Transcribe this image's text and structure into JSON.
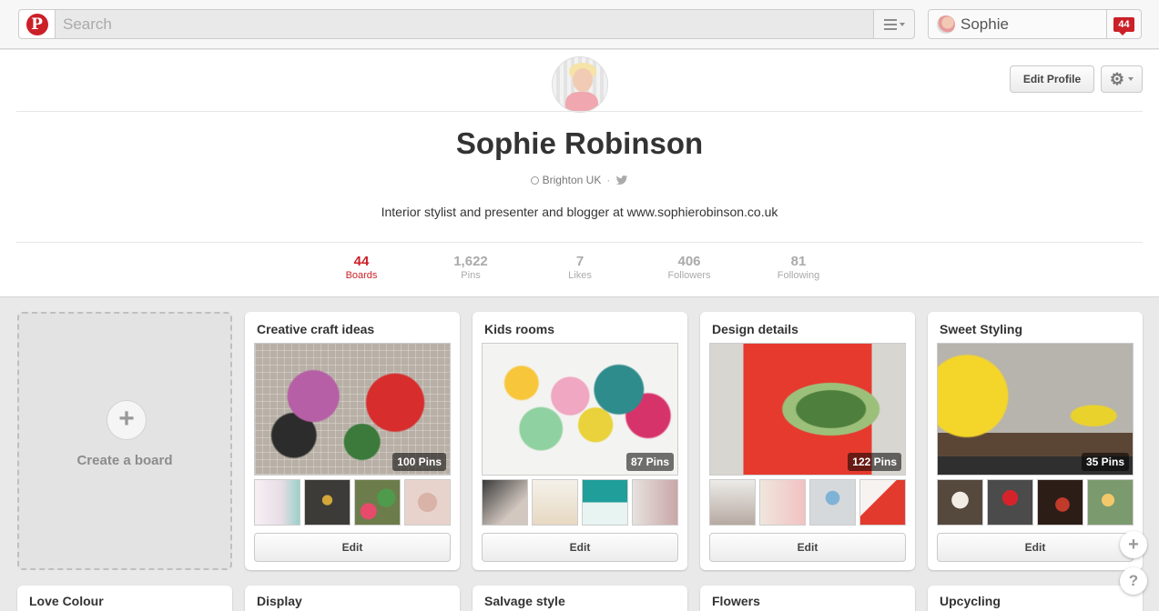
{
  "header": {
    "logo_letter": "P",
    "search_placeholder": "Search",
    "user_name": "Sophie",
    "notification_count": "44"
  },
  "profile": {
    "name": "Sophie Robinson",
    "location": "Brighton UK",
    "bio": "Interior stylist and presenter and blogger at www.sophierobinson.co.uk",
    "edit_profile_label": "Edit Profile",
    "stats": [
      {
        "num": "44",
        "label": "Boards"
      },
      {
        "num": "1,622",
        "label": "Pins"
      },
      {
        "num": "7",
        "label": "Likes"
      },
      {
        "num": "406",
        "label": "Followers"
      },
      {
        "num": "81",
        "label": "Following"
      }
    ]
  },
  "create_board_label": "Create a board",
  "edit_label": "Edit",
  "boards": [
    {
      "title": "Creative craft ideas",
      "pins": "100 Pins"
    },
    {
      "title": "Kids rooms",
      "pins": "87 Pins"
    },
    {
      "title": "Design details",
      "pins": "122 Pins"
    },
    {
      "title": "Sweet Styling",
      "pins": "35 Pins"
    }
  ],
  "boards_row2": [
    "Love Colour",
    "Display",
    "Salvage style",
    "Flowers",
    "Upcycling"
  ],
  "colors": {
    "accent": "#cb2027",
    "background": "#e9e9e9"
  }
}
